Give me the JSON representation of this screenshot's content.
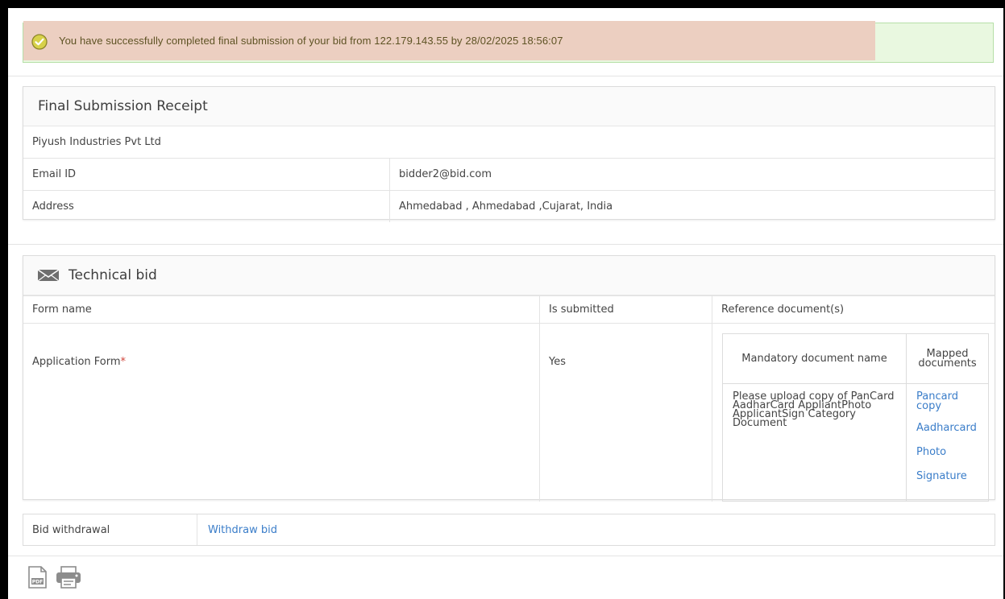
{
  "alert": {
    "message": "You have successfully completed final submission of your bid from 122.179.143.55 by 28/02/2025 18:56:07",
    "icon": "check-circle-icon",
    "colors": {
      "background": "#e9f8e0",
      "highlight": "#eccfc1",
      "text": "#5e5324"
    }
  },
  "receipt": {
    "title": "Final Submission Receipt",
    "company": "Piyush Industries Pvt Ltd",
    "rows": [
      {
        "label": "Email ID",
        "value": "bidder2@bid.com"
      },
      {
        "label": "Address",
        "value": "Ahmedabad , Ahmedabad ,Cujarat, India"
      }
    ]
  },
  "technical": {
    "title": "Technical bid",
    "icon": "envelope-icon",
    "headers": {
      "form": "Form name",
      "submitted": "Is submitted",
      "reference": "Reference document(s)"
    },
    "row": {
      "form": "Application Form",
      "required_mark": "*",
      "submitted": "Yes"
    },
    "docs": {
      "col1": "Mandatory document name",
      "col2": "Mapped documents",
      "mandatory": "Please upload copy of PanCard AadharCard AppliantPhoto ApplicantSign Category Document",
      "mapped": [
        "Pancard copy",
        "Aadharcard",
        "Photo",
        "Signature"
      ]
    }
  },
  "withdrawal": {
    "label": "Bid withdrawal",
    "link": "Withdraw bid"
  },
  "footer_icons": [
    "pdf-icon",
    "print-icon"
  ],
  "colors": {
    "link": "#3a7dc9",
    "required": "#d0453b"
  }
}
